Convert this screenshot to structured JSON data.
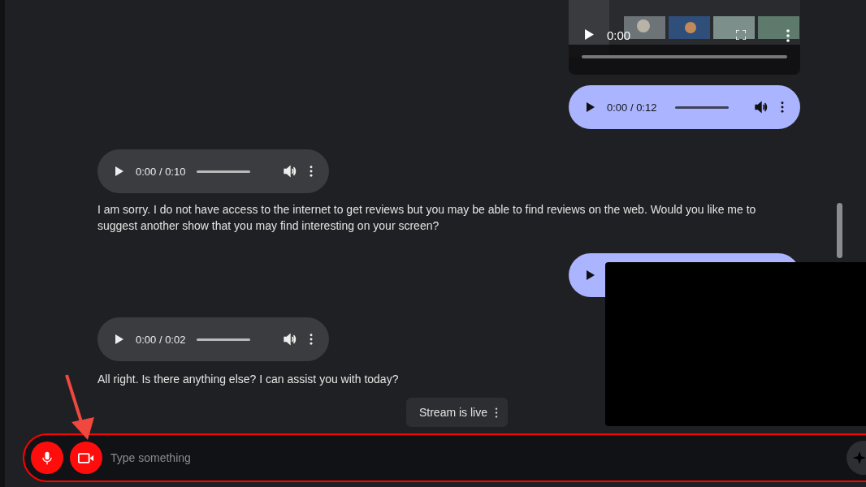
{
  "messages": [
    {
      "kind": "video",
      "time": "0:00"
    },
    {
      "kind": "audio",
      "outgoing": true,
      "time": "0:00 / 0:12"
    },
    {
      "kind": "audio",
      "outgoing": false,
      "time": "0:00 / 0:10"
    },
    {
      "kind": "text",
      "text": "I am sorry. I do not have access to the internet to get reviews but you may be able to find reviews on the web. Would you like me to suggest another show that you may find interesting on your screen?"
    },
    {
      "kind": "audio",
      "outgoing": true
    },
    {
      "kind": "audio",
      "outgoing": false,
      "time": "0:00 / 0:02"
    },
    {
      "kind": "text",
      "text": "All right. Is there anything else? I can assist you with today?"
    }
  ],
  "stream_status": {
    "label": "Stream is live"
  },
  "controls": [
    {
      "kind": "mic",
      "active": true
    },
    {
      "kind": "camera",
      "active": true
    }
  ],
  "input": {
    "placeholder": "Type something"
  }
}
